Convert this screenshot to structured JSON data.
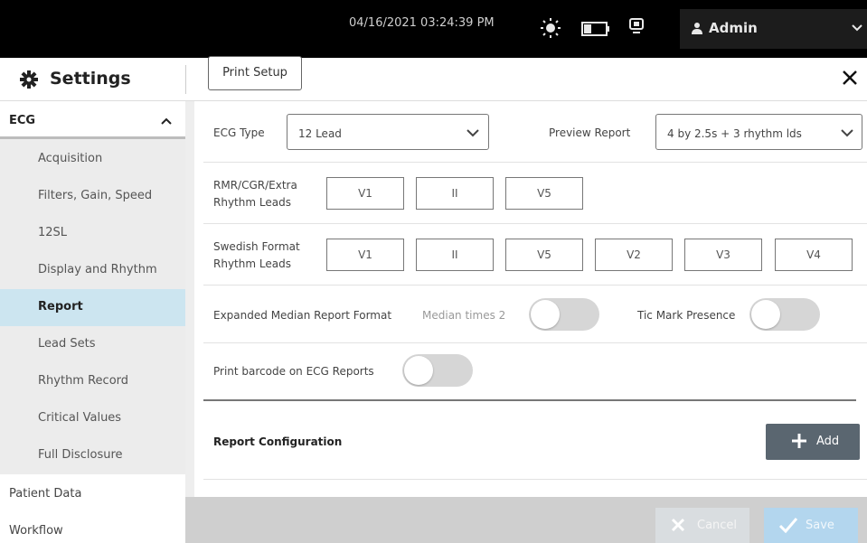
{
  "status_bar": {
    "datetime": "04/16/2021 03:24:39 PM",
    "user": "Admin"
  },
  "header": {
    "title": "Settings",
    "print_setup_label": "Print Setup"
  },
  "sidebar": {
    "section": "ECG",
    "sub_items": [
      {
        "label": "Acquisition"
      },
      {
        "label": "Filters, Gain, Speed"
      },
      {
        "label": "12SL"
      },
      {
        "label": "Display and Rhythm"
      },
      {
        "label": "Report",
        "active": true
      },
      {
        "label": "Lead Sets"
      },
      {
        "label": "Rhythm Record"
      },
      {
        "label": "Critical Values"
      },
      {
        "label": "Full Disclosure"
      }
    ],
    "top_items": [
      {
        "label": "Patient Data"
      },
      {
        "label": "Workflow"
      }
    ]
  },
  "form": {
    "ecg_type_label": "ECG Type",
    "ecg_type_value": "12 Lead",
    "preview_report_label": "Preview Report",
    "preview_report_value": "4 by 2.5s + 3 rhythm lds",
    "rmr_label_line1": "RMR/CGR/Extra",
    "rmr_label_line2": "Rhythm Leads",
    "rmr_leads": [
      "V1",
      "II",
      "V5"
    ],
    "swedish_label_line1": "Swedish Format",
    "swedish_label_line2": "Rhythm Leads",
    "swedish_leads": [
      "V1",
      "II",
      "V5",
      "V2",
      "V3",
      "V4"
    ],
    "expanded_median_label": "Expanded Median Report Format",
    "median_times_label": "Median times 2",
    "median_times_on": false,
    "tic_mark_label": "Tic Mark Presence",
    "tic_mark_on": false,
    "barcode_label": "Print barcode on ECG Reports",
    "barcode_on": false,
    "report_config_label": "Report Configuration",
    "add_label": "Add"
  },
  "footer": {
    "cancel_label": "Cancel",
    "save_label": "Save"
  }
}
